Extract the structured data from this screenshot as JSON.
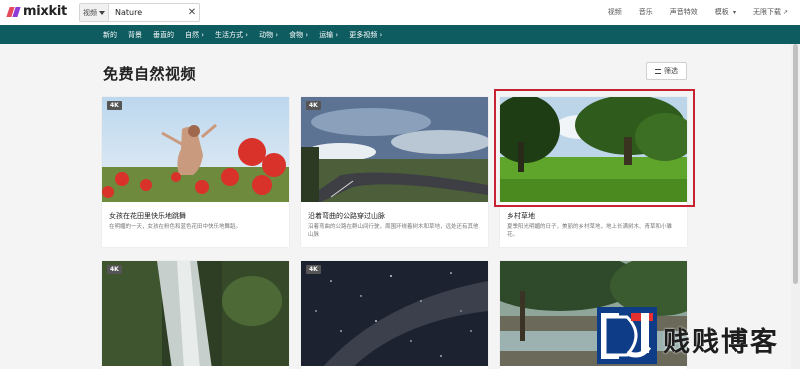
{
  "header": {
    "logo": "mixkit",
    "search": {
      "type": "视频",
      "value": "Nature"
    },
    "nav": [
      "视频",
      "音乐",
      "声音特效",
      "模板",
      "无限下载"
    ]
  },
  "categories": [
    "新的",
    "背景",
    "垂直的",
    "自然",
    "生活方式",
    "动物",
    "食物",
    "运输",
    "更多视频"
  ],
  "page": {
    "title": "免费自然视频",
    "filter_label": "筛选"
  },
  "cards": [
    {
      "badge": "4K",
      "title": "女孩在花田里快乐地跳舞",
      "description": "在明媚的一天，女孩在粉色和蓝色花田中快乐地舞蹈。"
    },
    {
      "badge": "4K",
      "title": "沿着弯曲的公路穿过山脉",
      "description": "沿着弯曲的公路在群山间行驶，周围环绕着树木和草地，远处还有其他山脉"
    },
    {
      "badge": "",
      "title": "乡村草地",
      "description": "夏季阳光明媚的日子，美丽的乡村草地，地上长满树木、青草和小雏花。"
    },
    {
      "badge": "4K",
      "title": "",
      "description": ""
    },
    {
      "badge": "4K",
      "title": "",
      "description": ""
    },
    {
      "badge": "",
      "title": "",
      "description": ""
    }
  ],
  "watermark": {
    "text": "贱贱博客"
  },
  "colors": {
    "accent_bar": "#0e5c60",
    "highlight": "#c82333",
    "badge": "#555555"
  }
}
